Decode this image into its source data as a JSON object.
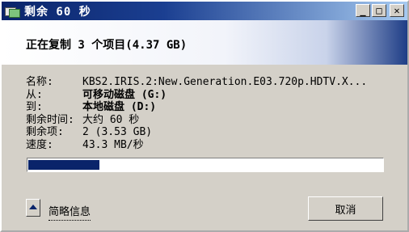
{
  "window": {
    "title": "剩余 60 秒"
  },
  "titlebar_buttons": {
    "minimize": "_",
    "maximize": "□",
    "close": "✕"
  },
  "header": {
    "text": "正在复制 3 个项目(4.37 GB)"
  },
  "details": {
    "name_label": "名称:",
    "name_value": "KBS2.IRIS.2:New.Generation.E03.720p.HDTV.X...",
    "from_label": "从:",
    "from_value": "可移动磁盘 (G:)",
    "to_label": "到:",
    "to_value": "本地磁盘 (D:)",
    "time_left_label": "剩余时间:",
    "time_left_value": "大约 60 秒",
    "items_left_label": "剩余项:",
    "items_left_value": "2 (3.53 GB)",
    "speed_label": "速度:",
    "speed_value": "43.3 MB/秒"
  },
  "progress": {
    "fraction": 0.2
  },
  "footer": {
    "less_info_label": "简略信息",
    "cancel_label": "取消"
  },
  "colors": {
    "titlebar_start": "#0a246a",
    "titlebar_end": "#a6caf0",
    "progress_fill": "#0a246a",
    "face": "#d4d0c8"
  },
  "icons": {
    "app": "copy-files-icon",
    "expand": "collapse-up-arrow-icon"
  }
}
